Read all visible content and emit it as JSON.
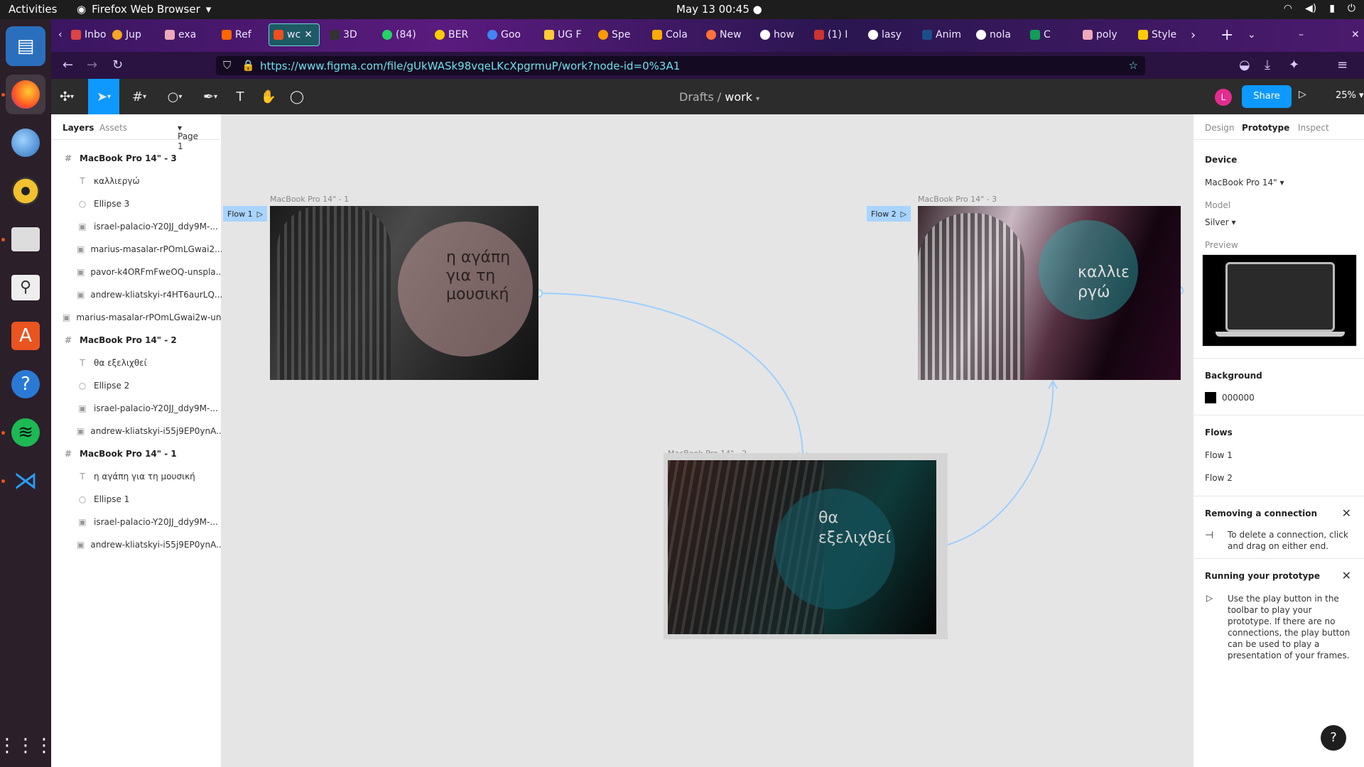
{
  "system": {
    "activities": "Activities",
    "app_name": "Firefox Web Browser",
    "clock": "May 13  00:45"
  },
  "browser": {
    "tabs": [
      "Inbo",
      "Jup",
      "exa",
      "Ref",
      "wc",
      "3D",
      "(84)",
      "BER",
      "Goo",
      "UG F",
      "Spe",
      "Cola",
      "New",
      "how",
      "(1) I",
      "lasy",
      "Anim",
      "nola",
      "C",
      "poly",
      "Style"
    ],
    "url": "https://www.figma.com/file/gUkWASk98vqeLKcXpgrmuP/work?node-id=0%3A1"
  },
  "figma": {
    "breadcrumb_drafts": "Drafts",
    "breadcrumb_sep": "/",
    "file_name": "work",
    "avatar_initial": "L",
    "share_label": "Share",
    "zoom": "25%"
  },
  "left_panel": {
    "tab_layers": "Layers",
    "tab_assets": "Assets",
    "page": "Page 1",
    "layers": [
      {
        "name": "MacBook Pro 14\" - 3",
        "type": "frame",
        "indent": 0
      },
      {
        "name": "καλλιεργώ",
        "type": "text",
        "indent": 1
      },
      {
        "name": "Ellipse 3",
        "type": "ellipse",
        "indent": 1
      },
      {
        "name": "israel-palacio-Y20JJ_ddy9M-...",
        "type": "image",
        "indent": 1
      },
      {
        "name": "marius-masalar-rPOmLGwai2...",
        "type": "image",
        "indent": 1
      },
      {
        "name": "pavor-k4ORFmFweOQ-unspla...",
        "type": "image",
        "indent": 1
      },
      {
        "name": "andrew-kliatskyi-r4HT6aurLQ...",
        "type": "image",
        "indent": 1
      },
      {
        "name": "marius-masalar-rPOmLGwai2w-un...",
        "type": "image",
        "indent": 0
      },
      {
        "name": "MacBook Pro 14\" - 2",
        "type": "frame",
        "indent": 0
      },
      {
        "name": "θα εξελιχθεί",
        "type": "text",
        "indent": 1
      },
      {
        "name": "Ellipse 2",
        "type": "ellipse",
        "indent": 1
      },
      {
        "name": "israel-palacio-Y20JJ_ddy9M-...",
        "type": "image",
        "indent": 1
      },
      {
        "name": "andrew-kliatskyi-i55j9EP0ynA...",
        "type": "image",
        "indent": 1
      },
      {
        "name": "MacBook Pro 14\" - 1",
        "type": "frame",
        "indent": 0
      },
      {
        "name": "η αγάπη για τη μουσική",
        "type": "text",
        "indent": 1
      },
      {
        "name": "Ellipse 1",
        "type": "ellipse",
        "indent": 1
      },
      {
        "name": "israel-palacio-Y20JJ_ddy9M-...",
        "type": "image",
        "indent": 1
      },
      {
        "name": "andrew-kliatskyi-i55j9EP0ynA...",
        "type": "image",
        "indent": 1
      }
    ]
  },
  "canvas": {
    "frame1": {
      "label": "MacBook Pro 14\" - 1",
      "flow": "Flow 1",
      "text": "η αγάπη\nγια τη\nμουσική"
    },
    "frame2": {
      "label": "MacBook Pro 14\" - 2",
      "text": "θα\nεξελιχθεί"
    },
    "frame3": {
      "label": "MacBook Pro 14\" - 3",
      "flow": "Flow 2",
      "text": "καλλιε\nργώ"
    }
  },
  "right_panel": {
    "tab_design": "Design",
    "tab_prototype": "Prototype",
    "tab_inspect": "Inspect",
    "device_title": "Device",
    "device_value": "MacBook Pro 14\"",
    "model_title": "Model",
    "model_value": "Silver",
    "preview_title": "Preview",
    "background_title": "Background",
    "background_value": "000000",
    "flows_title": "Flows",
    "flows": [
      "Flow 1",
      "Flow 2"
    ],
    "removing_title": "Removing a connection",
    "removing_text": "To delete a connection, click and drag on either end.",
    "running_title": "Running your prototype",
    "running_text": "Use the play button in the toolbar to play your prototype. If there are no connections, the play button can be used to play a presentation of your frames."
  },
  "colors": {
    "figma_blue": "#0d99ff",
    "flow_badge": "#a8d4ff",
    "connector": "#9ccfff"
  }
}
